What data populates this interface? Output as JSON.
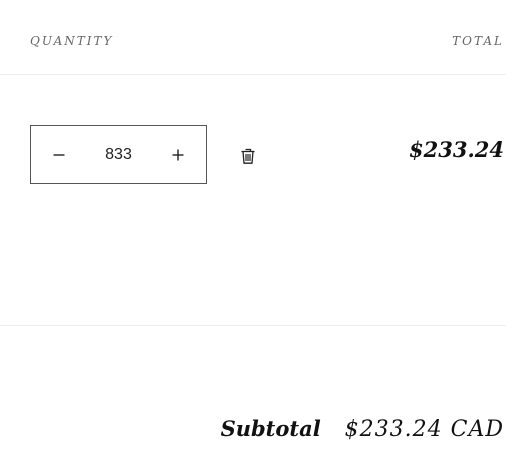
{
  "header": {
    "quantity_label": "QUANTITY",
    "total_label": "TOTAL"
  },
  "line_item": {
    "quantity": "833",
    "price": "$233.24",
    "decrement_icon": "minus-icon",
    "increment_icon": "plus-icon",
    "remove_icon": "trash-icon"
  },
  "summary": {
    "subtotal_label": "Subtotal",
    "subtotal_value": "$233.24 CAD"
  },
  "colors": {
    "text": "#111111",
    "muted": "#666666",
    "border": "#555555",
    "divider": "#ececec"
  }
}
